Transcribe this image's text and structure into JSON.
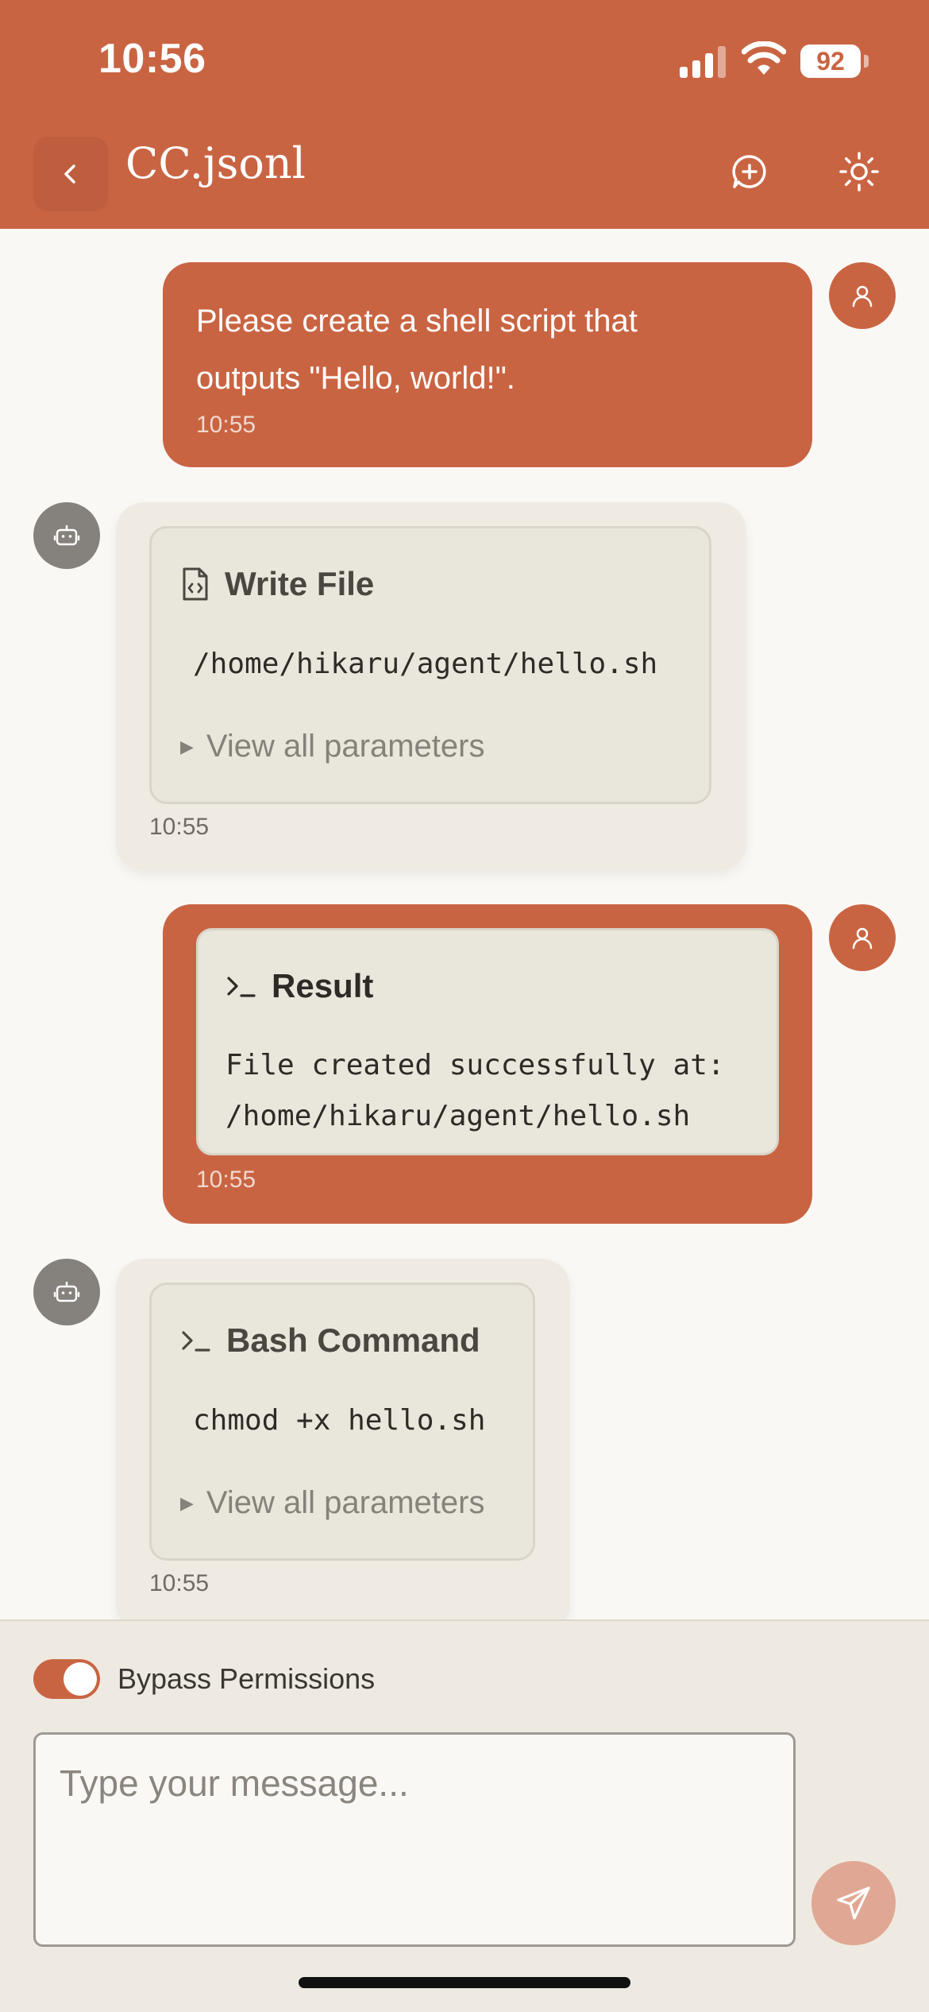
{
  "status_bar": {
    "time": "10:56",
    "battery": "92"
  },
  "header": {
    "title": "CC.jsonl",
    "back_icon": "chevron-left-icon",
    "new_chat_icon": "message-plus-icon",
    "theme_icon": "sun-icon"
  },
  "colors": {
    "accent": "#c96442",
    "bot_avatar": "#85827d",
    "bot_bubble": "#efebe3",
    "tool_card": "#e9e6dc"
  },
  "messages": [
    {
      "role": "user",
      "text_lines": [
        "Please create a shell script that",
        "outputs \"Hello, world!\"."
      ],
      "time": "10:55"
    },
    {
      "role": "assistant",
      "tool": {
        "name": "Write File",
        "icon": "file-code-icon",
        "argument": "/home/hikaru/agent/hello.sh",
        "expand_label": "View all parameters"
      },
      "time": "10:55"
    },
    {
      "role": "user",
      "result": {
        "label": "Result",
        "icon": "terminal-icon",
        "lines": [
          "File created successfully at:",
          "/home/hikaru/agent/hello.sh"
        ]
      },
      "time": "10:55"
    },
    {
      "role": "assistant",
      "tool": {
        "name": "Bash Command",
        "icon": "terminal-icon",
        "argument": "chmod +x hello.sh",
        "expand_label": "View all parameters"
      },
      "time": "10:55"
    }
  ],
  "composer": {
    "bypass_label": "Bypass Permissions",
    "bypass_enabled": true,
    "placeholder": "Type your message...",
    "value": "",
    "send_icon": "send-icon"
  }
}
